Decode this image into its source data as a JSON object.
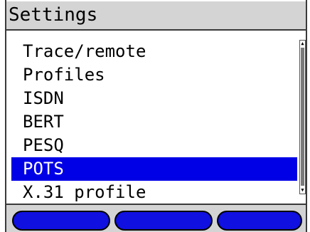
{
  "header": {
    "title": "Settings"
  },
  "menu": {
    "items": [
      {
        "label": "Trace/remote",
        "selected": false
      },
      {
        "label": "Profiles",
        "selected": false
      },
      {
        "label": "ISDN",
        "selected": false
      },
      {
        "label": "BERT",
        "selected": false
      },
      {
        "label": "PESQ",
        "selected": false
      },
      {
        "label": "POTS",
        "selected": true
      },
      {
        "label": "X.31 profile",
        "selected": false
      }
    ]
  },
  "scrollbar": {
    "up_icon": "triangle-up-icon",
    "down_icon": "triangle-down-icon"
  },
  "softkeys": {
    "key1_label": "",
    "key2_label": "",
    "key3_label": ""
  },
  "colors": {
    "selection": "#0000e6",
    "softkey": "#1010e0",
    "titlebar": "#d4d4d4"
  }
}
